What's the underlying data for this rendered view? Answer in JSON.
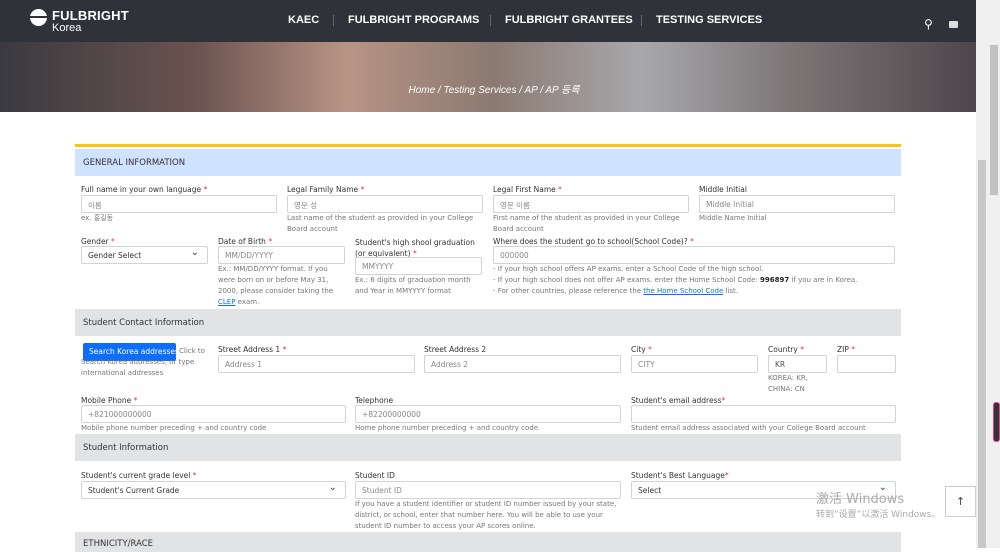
{
  "header": {
    "logo_line1": "FULBRIGHT",
    "logo_line2": "Korea",
    "nav": [
      "KAEC",
      "FULBRIGHT PROGRAMS",
      "FULBRIGHT GRANTEES",
      "TESTING SERVICES"
    ]
  },
  "breadcrumb": "Home / Testing Services / AP / AP 등록",
  "general": {
    "title": "GENERAL INFORMATION",
    "full_name": {
      "label": "Full name in your own language",
      "placeholder": "이름",
      "help": "ex. 홍길동"
    },
    "family_name": {
      "label": "Legal Family Name",
      "placeholder": "영문 성",
      "help": "Last name of the student as provided in your College Board account"
    },
    "first_name": {
      "label": "Legal First Name",
      "placeholder": "영문 이름",
      "help": "First name of the student as provided in your College Board account"
    },
    "middle": {
      "label": "Middle Initial",
      "placeholder": "Middle Initial",
      "help": "Middle Name Initial"
    },
    "gender": {
      "label": "Gender",
      "value": "Gender Select"
    },
    "dob": {
      "label": "Date of Birth",
      "placeholder": "MM/DD/YYYY",
      "help": "Ex.: MM/DD/YYYY format. If you were born on or before May 31, 2000, please consider taking the",
      "link": "CLEP",
      "help_end": " exam."
    },
    "grad": {
      "label": "Student's high shool graduation (or equivalent)",
      "placeholder": "MMYYYY",
      "help": "Ex.: 6 digits of graduation month and Year in MMYYYY format"
    },
    "school": {
      "label": "Where does the student go to school(School Code)?",
      "placeholder": "000000",
      "help1": "- If your high school offers AP exams. enter a School Code of the high school.",
      "help2": "- If your high school does not offer AP exams. enter the Home School Code: ",
      "code": "996897",
      "help2_end": " if you are in Korea.",
      "help3": "- For other countries, please reference the ",
      "link": "the Home School Code",
      "help3_end": " list."
    }
  },
  "contact": {
    "title": "Student Contact Information",
    "search_btn": "Search Korea addresses",
    "search_help": "Click to Search Korea addresses, or type international addresses",
    "addr1": {
      "label": "Street Address 1",
      "placeholder": "Address 1"
    },
    "addr2": {
      "label": "Street Address 2",
      "placeholder": "Address 2"
    },
    "city": {
      "label": "City",
      "placeholder": "CITY"
    },
    "country": {
      "label": "Country",
      "value": "KR",
      "help": "KOREA: KR, CHINA: CN"
    },
    "zip": {
      "label": "ZIP"
    },
    "mobile": {
      "label": "Mobile Phone",
      "placeholder": "+821000000000",
      "help": "Mobile phone number preceding + and country code"
    },
    "tel": {
      "label": "Telephone",
      "placeholder": "+82200000000",
      "help": "Home phone number preceding + and country code"
    },
    "email": {
      "label": "Student's email address",
      "help": "Student email address associated with your College Board account"
    }
  },
  "student": {
    "title": "Student Information",
    "grade": {
      "label": "Student's current grade level",
      "value": "Student's Current Grade"
    },
    "id": {
      "label": "Student ID",
      "placeholder": "Student ID",
      "help": "If you have a student identifier or student ID number issued by your state, district, or school, enter that number here. You will be able to use your student ID number to access your AP scores online."
    },
    "lang": {
      "label": "Student's Best Language",
      "value": "Select"
    }
  },
  "ethnicity": {
    "title": "ETHNICITY/RACE"
  },
  "watermark": {
    "line1": "激活 Windows",
    "line2": "转到“设置”以激活 Windows。"
  }
}
